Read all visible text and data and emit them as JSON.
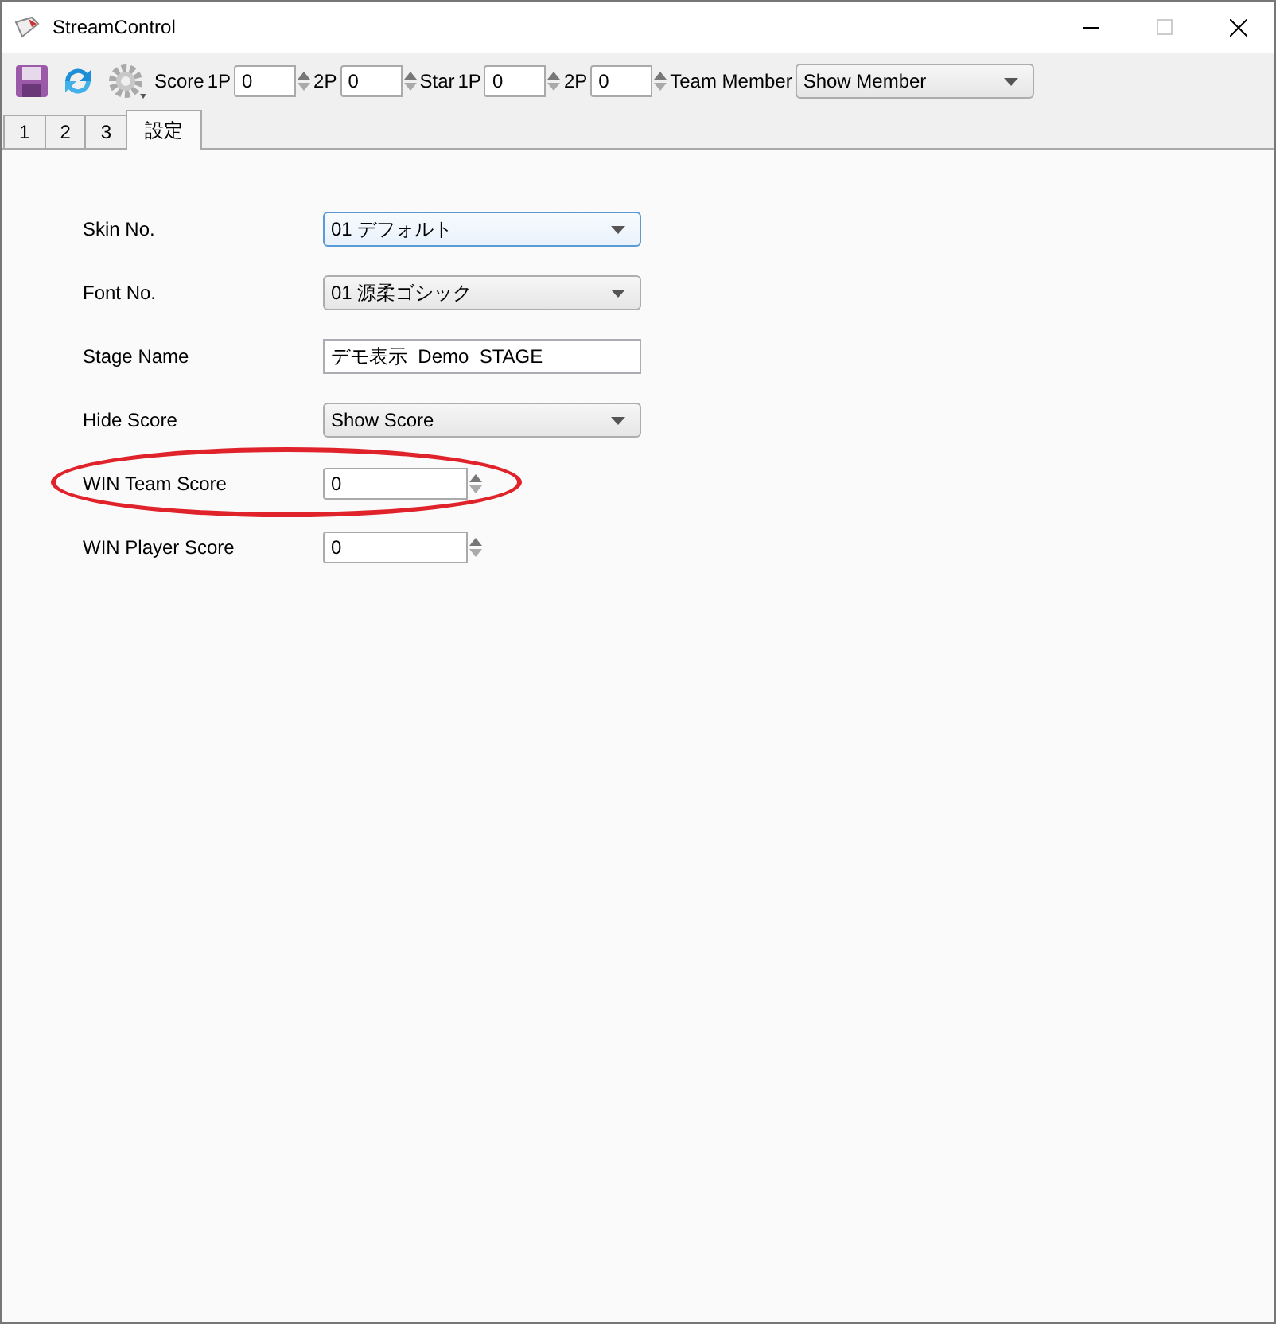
{
  "window": {
    "title": "StreamControl"
  },
  "toolbar": [
    {
      "kind": "label",
      "text": "Score"
    },
    {
      "kind": "label",
      "text": "1P"
    },
    {
      "kind": "spin",
      "value": "0"
    },
    {
      "kind": "label",
      "text": "2P"
    },
    {
      "kind": "spin",
      "value": "0"
    },
    {
      "kind": "label",
      "text": "Star"
    },
    {
      "kind": "label",
      "text": "1P"
    },
    {
      "kind": "spin",
      "value": "0"
    },
    {
      "kind": "label",
      "text": "2P"
    },
    {
      "kind": "spin",
      "value": "0"
    },
    {
      "kind": "label",
      "text": "Team Member"
    },
    {
      "kind": "select",
      "value": "Show Member"
    }
  ],
  "tabs": [
    {
      "label": "1",
      "selected": false
    },
    {
      "label": "2",
      "selected": false
    },
    {
      "label": "3",
      "selected": false
    },
    {
      "label": "設定",
      "selected": true
    }
  ],
  "form": [
    {
      "label": "Skin No.",
      "kind": "select",
      "value": "01 デフォルト",
      "focused": true,
      "highlighted": false
    },
    {
      "label": "Font No.",
      "kind": "select",
      "value": "01 源柔ゴシック",
      "focused": false,
      "highlighted": false
    },
    {
      "label": "Stage Name",
      "kind": "text",
      "value": "デモ表示  Demo  STAGE",
      "focused": false,
      "highlighted": false
    },
    {
      "label": "Hide Score",
      "kind": "select",
      "value": "Show Score",
      "focused": false,
      "highlighted": false
    },
    {
      "label": "WIN Team Score",
      "kind": "spin",
      "value": "0",
      "focused": false,
      "highlighted": true
    },
    {
      "label": "WIN Player Score",
      "kind": "spin",
      "value": "0",
      "focused": false,
      "highlighted": false
    }
  ]
}
